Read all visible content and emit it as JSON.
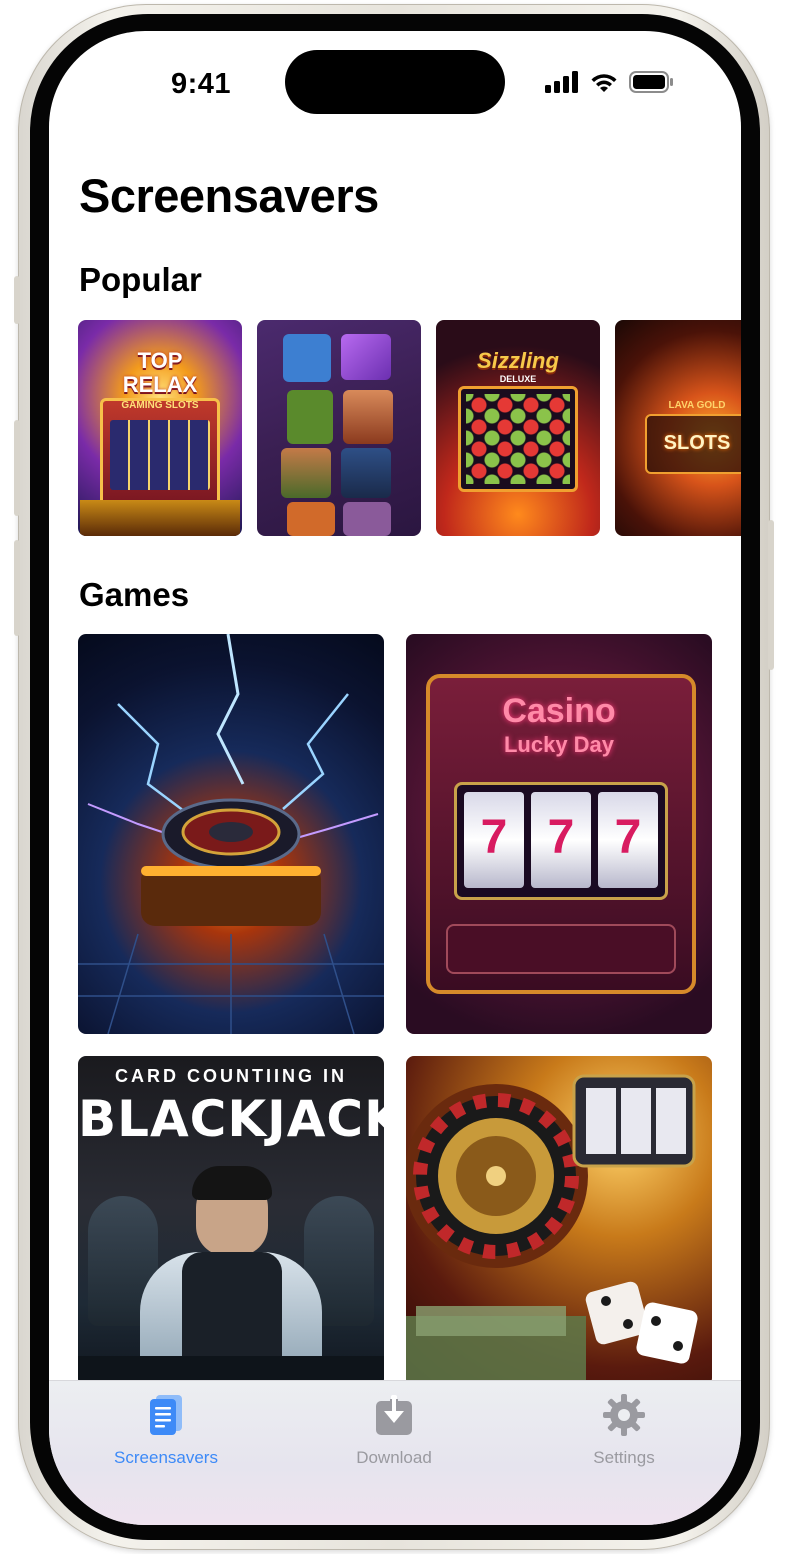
{
  "status_bar": {
    "time": "9:41"
  },
  "page": {
    "title": "Screensavers"
  },
  "popular": {
    "title": "Popular",
    "items": [
      {
        "name": "Top Relax Gaming Slots",
        "art_text_1": "TOP",
        "art_text_2": "RELAX",
        "art_text_3": "GAMING SLOTS"
      },
      {
        "name": "Character Slot Reels"
      },
      {
        "name": "Sizzling Deluxe",
        "art_text_1": "Sizzling",
        "art_text_2": "DELUXE"
      },
      {
        "name": "Lava Gold Slots",
        "art_text_1": "LAVA GOLD",
        "art_text_2": "SLOTS"
      }
    ]
  },
  "games": {
    "title": "Games",
    "items": [
      {
        "name": "Lightning Roulette"
      },
      {
        "name": "Casino Lucky Day",
        "art_text_1": "Casino",
        "art_text_2": "Lucky Day",
        "reel": "7"
      },
      {
        "name": "Card Counting in Blackjack",
        "art_text_1": "CARD COUNTIING IN",
        "art_text_2": "BLACKJACK"
      },
      {
        "name": "Roulette Dice Money"
      }
    ]
  },
  "tabbar": {
    "tabs": [
      {
        "label": "Screensavers",
        "icon": "document-icon",
        "active": true
      },
      {
        "label": "Download",
        "icon": "download-icon",
        "active": false
      },
      {
        "label": "Settings",
        "icon": "gear-icon",
        "active": false
      }
    ],
    "active_color": "#3d8af7",
    "inactive_color": "#9a9aa0"
  }
}
